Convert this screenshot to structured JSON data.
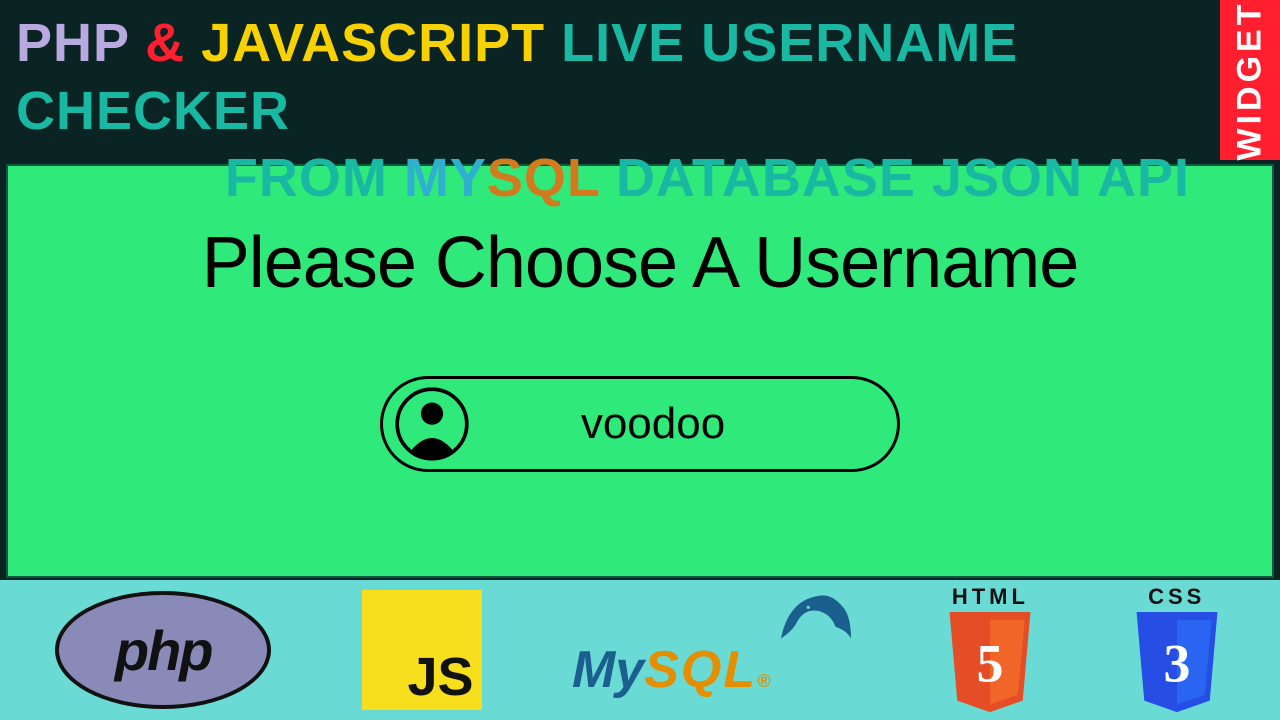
{
  "header": {
    "line1": {
      "w1": "PHP",
      "amp": "&",
      "w2": "JAVASCRIPT",
      "rest": "LIVE USERNAME CHECKER"
    },
    "line2": {
      "w1": "FROM",
      "my": "MY",
      "sql": "SQL",
      "rest": "DATABASE JSON API"
    },
    "badge": "WIDGET"
  },
  "panel": {
    "prompt": "Please Choose A Username",
    "input_value": "voodoo"
  },
  "footer": {
    "php": "php",
    "js": "JS",
    "mysql_my": "My",
    "mysql_sql": "SQL",
    "mysql_dot": "®",
    "html_label": "HTML",
    "html_num": "5",
    "css_label": "CSS",
    "css_num": "3"
  }
}
